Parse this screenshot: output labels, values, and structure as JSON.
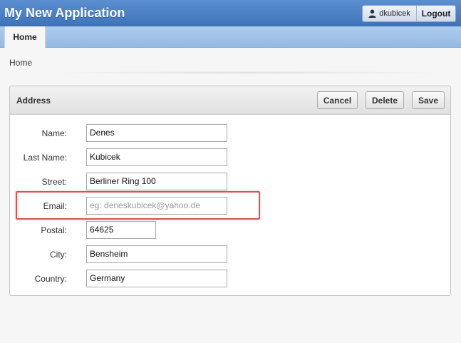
{
  "header": {
    "app_title": "My New Application",
    "username": "dkubicek",
    "logout_label": "Logout"
  },
  "tabs": [
    {
      "label": "Home",
      "active": true
    }
  ],
  "breadcrumb": "Home",
  "region": {
    "title": "Address",
    "buttons": {
      "cancel": "Cancel",
      "delete": "Delete",
      "save": "Save"
    },
    "fields": {
      "name": {
        "label": "Name:",
        "value": "Denes"
      },
      "last_name": {
        "label": "Last Name:",
        "value": "Kubicek"
      },
      "street": {
        "label": "Street:",
        "value": "Berliner Ring 100"
      },
      "email": {
        "label": "Email:",
        "value": "",
        "placeholder": "eg: deneskubicek@yahoo.de"
      },
      "postal": {
        "label": "Postal:",
        "value": "64625"
      },
      "city": {
        "label": "City:",
        "value": "Bensheim"
      },
      "country": {
        "label": "Country:",
        "value": "Germany"
      }
    }
  },
  "colors": {
    "header_blue": "#4a7fc2",
    "tab_blue": "#a5c6ea",
    "highlight_red": "#d9534f"
  }
}
